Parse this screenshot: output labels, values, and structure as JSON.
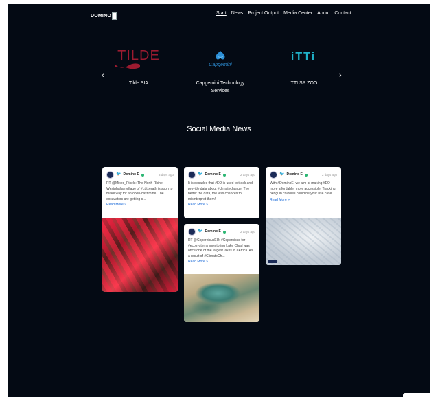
{
  "header": {
    "logo_text": "DOMINO",
    "nav": [
      "Start",
      "News",
      "Project Output",
      "Media Center",
      "About",
      "Contact"
    ]
  },
  "carousel": {
    "prev_label": "‹",
    "next_label": "›",
    "partners": [
      {
        "logo_text": "TILDE",
        "name": "Tilde SIA"
      },
      {
        "logo_text": "Capgemini",
        "name": "Capgemini Technology Services"
      },
      {
        "logo_text": "iTTi",
        "name": "ITTI SP ZOO"
      }
    ]
  },
  "section_title": "Social Media News",
  "colors": {
    "background": "#040a14",
    "tilde": "#9b1b30",
    "capgemini": "#2d8fd6",
    "itti": "#1fb1c8",
    "link": "#1a6ad8"
  },
  "posts": [
    {
      "author": "Domino E",
      "ago": "3 days ago",
      "text": "RT @Mixed_Pixels: The North Rhine-Westphalian village of #Lützerath is soon to make way for an open-cast mine. The excavators are getting c...",
      "read_more": "Read More »"
    },
    {
      "author": "Domino E",
      "ago": "2 days ago",
      "text": "It is decades that #EO is used to track and provide data about #climatechange. The better the data, the less chances to misinterpret them!",
      "read_more": "Read More »"
    },
    {
      "author": "Domino E",
      "ago": "2 days ago",
      "text": "With #DominoE, we aim at making #EO more affordable; more accessible. Tracking penguin colonies could be your use case.",
      "read_more": "Read More »"
    },
    {
      "author": "Domino E",
      "ago": "2 days ago",
      "text": "RT @CopernicusEU: #Copernicus for #ecosystems monitoring Lake Chad was once one of the largest lakes in #Africa. As a result of #ClimateCh...",
      "read_more": "Read More »"
    }
  ]
}
